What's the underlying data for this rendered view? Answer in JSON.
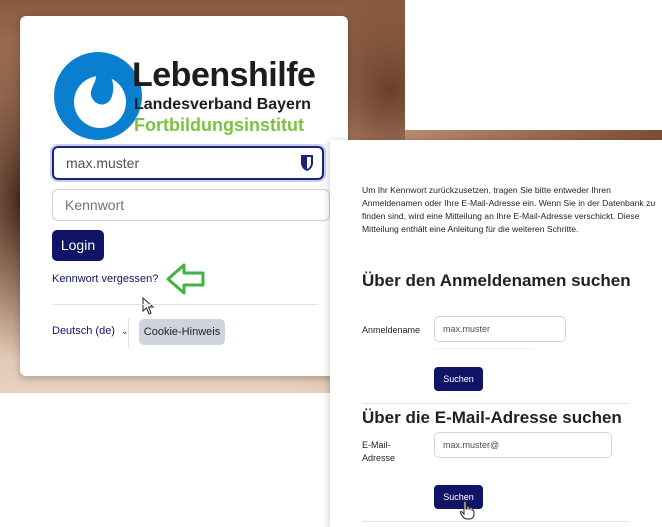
{
  "login": {
    "logo_line1": "Lebenshilfe",
    "logo_line2": "Landesverband Bayern",
    "logo_line3": "Fortbildungsinstitut",
    "username_value": "max.muster",
    "password_placeholder": "Kennwort",
    "login_button": "Login",
    "forgot_link": "Kennwort vergessen?",
    "language": "Deutsch (de)",
    "cookie_button": "Cookie-Hinweis"
  },
  "reset": {
    "intro": "Um Ihr Kennwort zurückzusetzen, tragen Sie bitte entweder Ihren Anmeldenamen oder Ihre E-Mail-Adresse ein. Wenn Sie in der Datenbank zu finden sind, wird eine Mitteilung an Ihre E-Mail-Adresse verschickt. Diese Mitteilung enthält eine Anleitung für die weiteren Schritte.",
    "heading_username": "Über den Anmeldenamen suchen",
    "username_label": "Anmeldename",
    "username_value": "max.muster",
    "search_button_1": "Suchen",
    "heading_email": "Über die E-Mail-Adresse suchen",
    "email_label": "E-Mail-Adresse",
    "email_value": "max.muster@",
    "search_button_2": "Suchen"
  },
  "colors": {
    "primary": "#0f1467",
    "logo_blue": "#0a7fd0",
    "logo_green": "#7ec242",
    "arrow_green": "#3fb33f"
  }
}
